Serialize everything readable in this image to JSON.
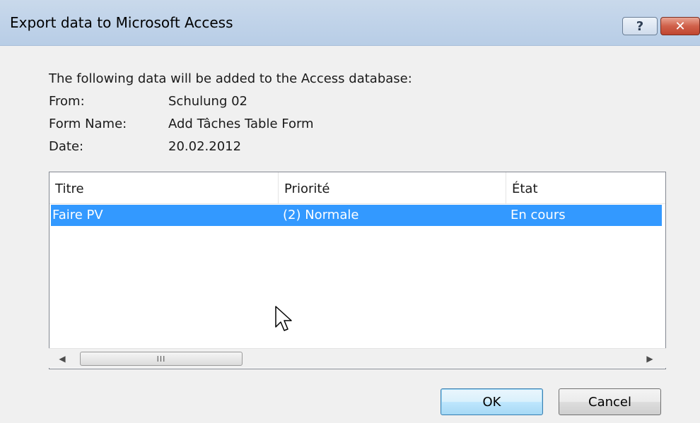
{
  "window": {
    "title": "Export data to Microsoft Access",
    "help_glyph": "?",
    "close_glyph": "✕"
  },
  "summary": {
    "intro": "The following data will be added to the Access database:",
    "fields": [
      {
        "label": "From:",
        "value": "Schulung 02"
      },
      {
        "label": "Form Name:",
        "value": "Add Tâches Table Form"
      },
      {
        "label": "Date:",
        "value": "20.02.2012"
      }
    ]
  },
  "table": {
    "columns": [
      "Titre",
      "Priorité",
      "État"
    ],
    "rows": [
      {
        "titre": "Faire PV",
        "priorite": "(2) Normale",
        "etat": "En cours",
        "selected": true
      }
    ],
    "scroll_left_glyph": "◀",
    "scroll_right_glyph": "▶",
    "scroll_thumb_grip": "III"
  },
  "buttons": {
    "ok": "OK",
    "cancel": "Cancel"
  },
  "colors": {
    "selection": "#3399ff",
    "titlebar": "#c0d3e9",
    "close_button": "#c04630"
  },
  "icons": {
    "help": "help-icon",
    "close": "close-icon",
    "cursor": "mouse-pointer-icon"
  }
}
